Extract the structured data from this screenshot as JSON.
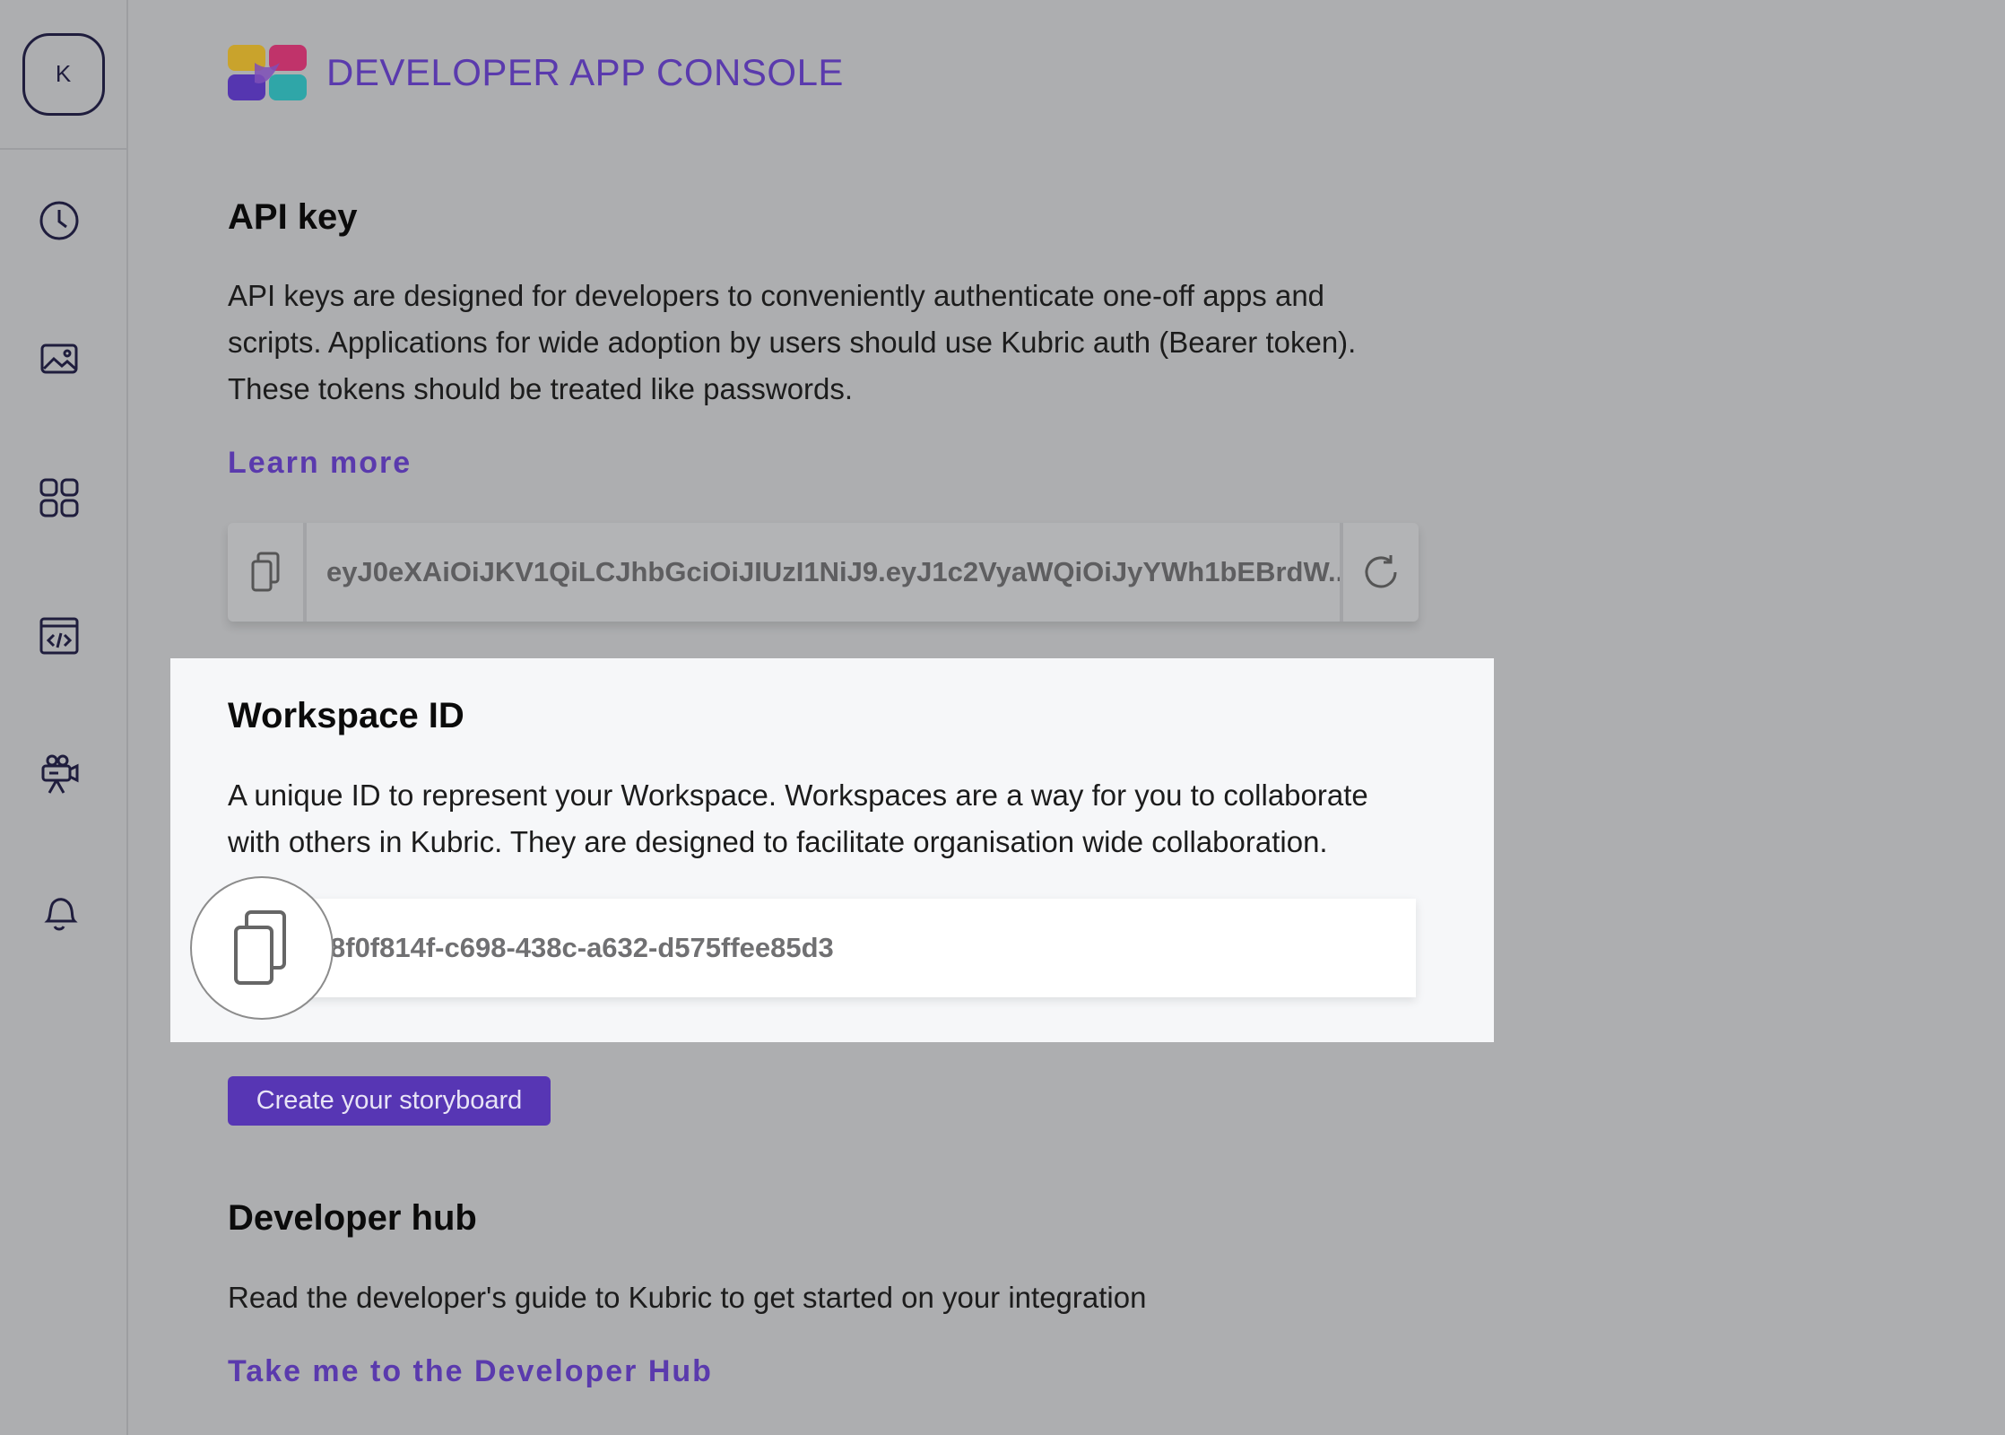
{
  "sidebar": {
    "avatar_initial": "K",
    "items": [
      {
        "icon": "clock-icon"
      },
      {
        "icon": "image-icon"
      },
      {
        "icon": "grid-icon"
      },
      {
        "icon": "code-window-icon"
      },
      {
        "icon": "video-camera-icon"
      },
      {
        "icon": "bell-icon"
      }
    ]
  },
  "header": {
    "brand_title": "DEVELOPER APP CONSOLE"
  },
  "api_key": {
    "heading": "API key",
    "description_lines": [
      "API keys are designed for developers to conveniently authenticate one-off apps and",
      "scripts. Applications for wide adoption by users should use Kubric auth (Bearer token).",
      "These tokens should be treated like passwords."
    ],
    "learn_more": "Learn more",
    "value": "eyJ0eXAiOiJKV1QiLCJhbGciOiJIUzI1NiJ9.eyJ1c2VyaWQiOiJyYWh1bEBrdW..."
  },
  "workspace": {
    "heading": "Workspace ID",
    "description_lines": [
      "A unique ID to represent your Workspace. Workspaces are a way for you to collaborate",
      "with others in Kubric. They are designed to facilitate organisation wide collaboration."
    ],
    "id": "8f0f814f-c698-438c-a632-d575ffee85d3"
  },
  "storyboard_button": "Create your storyboard",
  "developer_hub": {
    "heading": "Developer hub",
    "description": "Read the developer's guide to Kubric to get started on your integration",
    "link": "Take me to the Developer Hub"
  },
  "colors": {
    "accent": "#5a3aad",
    "background": "#adaeb0",
    "highlight_panel": "#f6f7f9"
  }
}
